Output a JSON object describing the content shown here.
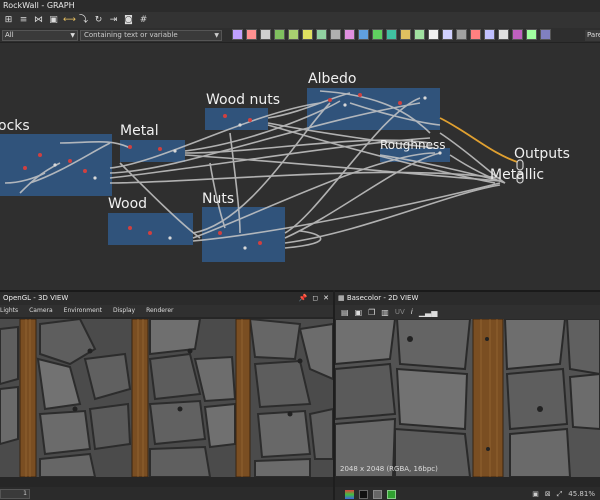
{
  "graph": {
    "title": "RockWall - GRAPH",
    "filter": {
      "selected": "All",
      "search_placeholder": "Containing text or variable"
    },
    "params_label": "Pare",
    "frames": {
      "rocks": "ocks",
      "metal": "Metal",
      "wood_nuts": "Wood nuts",
      "albedo": "Albedo",
      "roughness": "Roughness",
      "outputs": "Outputs",
      "metallic": "Metallic",
      "wood": "Wood",
      "nuts": "Nuts"
    },
    "node_icon_colors": [
      "#c0a0ff",
      "#ff9090",
      "#d0d0d0",
      "#7fbf5f",
      "#a8d070",
      "#dfe060",
      "#90d0a0",
      "#b0b0b0",
      "#e090e0",
      "#60a0e0",
      "#60d060",
      "#40c0a0",
      "#e0c060",
      "#a0e0a0",
      "#f0f0f0",
      "#d0d0ff",
      "#a0a0a0",
      "#ff8080",
      "#c0c0ff",
      "#e0e0e0",
      "#c060c0",
      "#a0ffa0",
      "#8080c0"
    ]
  },
  "view3d": {
    "title": "OpenGL - 3D VIEW",
    "menu": [
      "Lights",
      "Camera",
      "Environment",
      "Display",
      "Renderer"
    ],
    "footer_value": "1"
  },
  "view2d": {
    "title": "Basecolor - 2D VIEW",
    "toolbar_label": "UV",
    "resolution": "2048 x 2048 (RGBA, 16bpc)",
    "zoom": "45.81%"
  }
}
